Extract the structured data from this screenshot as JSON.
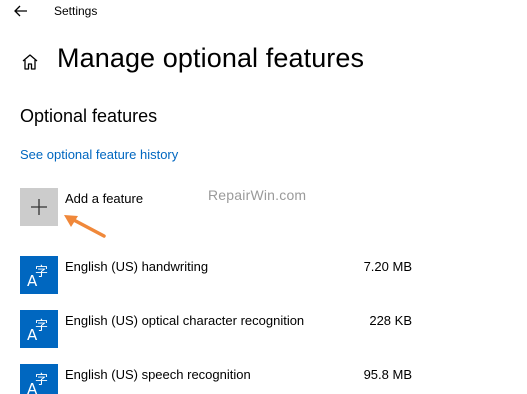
{
  "window": {
    "title": "Settings"
  },
  "header": {
    "title": "Manage optional features"
  },
  "section": {
    "title": "Optional features",
    "history_link": "See optional feature history"
  },
  "add_feature": {
    "label": "Add a feature",
    "icon": "plus-icon"
  },
  "watermark": "RepairWin.com",
  "features": [
    {
      "name": "English (US) handwriting",
      "size": "7.20 MB",
      "icon": "language-icon"
    },
    {
      "name": "English (US) optical character recognition",
      "size": "228 KB",
      "icon": "language-icon"
    },
    {
      "name": "English (US) speech recognition",
      "size": "95.8 MB",
      "icon": "language-icon"
    }
  ],
  "colors": {
    "accent": "#0067c0",
    "add_tile": "#cccccc",
    "annotation_arrow": "#f0883a"
  }
}
